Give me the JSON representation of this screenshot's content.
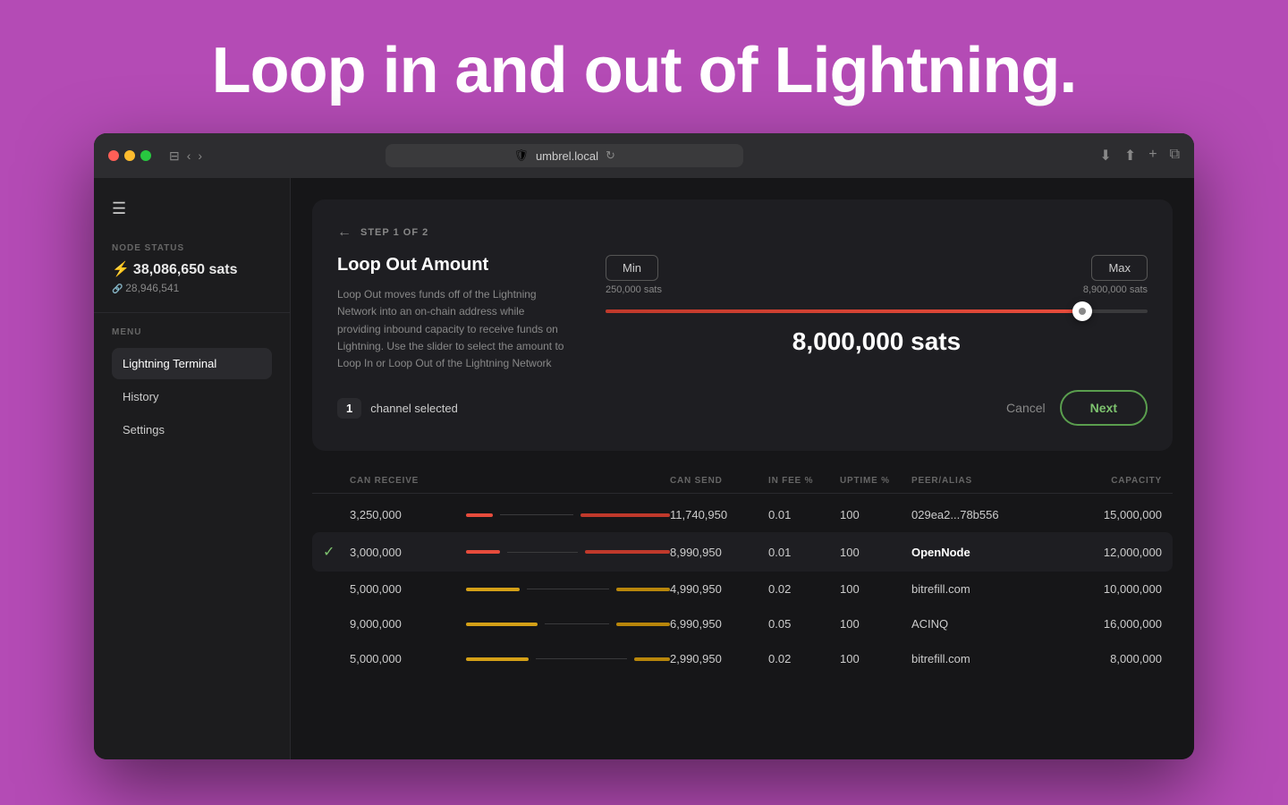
{
  "page": {
    "background_color": "#b44bb5",
    "hero_title": "Loop in and out of Lightning."
  },
  "browser": {
    "url": "umbrel.local",
    "tab_title": "umbrel.local"
  },
  "sidebar": {
    "node_status_label": "NODE STATUS",
    "balance_lightning": "38,086,650 sats",
    "balance_chain": "28,946,541",
    "menu_label": "MENU",
    "menu_items": [
      {
        "label": "Lightning Terminal",
        "active": true
      },
      {
        "label": "History",
        "active": false
      },
      {
        "label": "Settings",
        "active": false
      }
    ]
  },
  "loop_out": {
    "step_label": "STEP 1 OF 2",
    "title": "Loop Out Amount",
    "description": "Loop Out moves funds off of the Lightning Network into an on-chain address while providing inbound capacity to receive funds on Lightning. Use the slider to select the amount to Loop In or Loop Out of the Lightning Network",
    "min_label": "Min",
    "min_value": "250,000 sats",
    "max_label": "Max",
    "max_value": "8,900,000 sats",
    "slider_value": "8,000,000 sats",
    "slider_position_pct": 88,
    "channel_count": "1",
    "channel_selected_text": "channel selected",
    "cancel_label": "Cancel",
    "next_label": "Next"
  },
  "table": {
    "headers": [
      "",
      "CAN RECEIVE",
      "",
      "CAN SEND",
      "IN FEE %",
      "UPTIME %",
      "PEER/ALIAS",
      "CAPACITY"
    ],
    "rows": [
      {
        "selected": false,
        "can_receive": "3,250,000",
        "bar_receive_pct": 22,
        "bar_send_pct": 78,
        "can_send": "11,740,950",
        "in_fee": "0.01",
        "uptime": "100",
        "peer": "029ea2...78b556",
        "capacity": "15,000,000"
      },
      {
        "selected": true,
        "can_receive": "3,000,000",
        "bar_receive_pct": 25,
        "bar_send_pct": 75,
        "can_send": "8,990,950",
        "in_fee": "0.01",
        "uptime": "100",
        "peer": "OpenNode",
        "capacity": "12,000,000"
      },
      {
        "selected": false,
        "can_receive": "5,000,000",
        "bar_receive_pct": 50,
        "bar_send_pct": 50,
        "can_send": "4,990,950",
        "in_fee": "0.02",
        "uptime": "100",
        "peer": "bitrefill.com",
        "capacity": "10,000,000"
      },
      {
        "selected": false,
        "can_receive": "9,000,000",
        "bar_receive_pct": 56,
        "bar_send_pct": 44,
        "can_send": "6,990,950",
        "in_fee": "0.05",
        "uptime": "100",
        "peer": "ACINQ",
        "capacity": "16,000,000"
      },
      {
        "selected": false,
        "can_receive": "5,000,000",
        "bar_receive_pct": 62,
        "bar_send_pct": 38,
        "can_send": "2,990,950",
        "in_fee": "0.02",
        "uptime": "100",
        "peer": "bitrefill.com",
        "capacity": "8,000,000"
      }
    ]
  }
}
